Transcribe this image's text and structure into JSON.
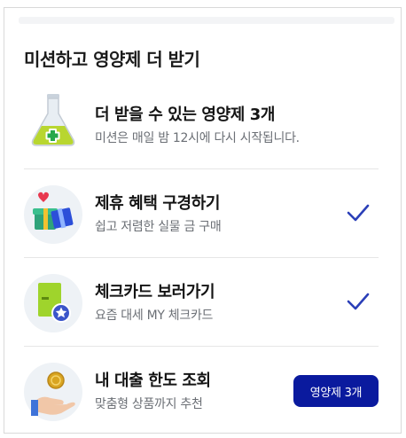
{
  "section": {
    "title": "미션하고 영양제 더 받기"
  },
  "summary": {
    "title": "더 받을 수 있는 영양제 3개",
    "subtitle": "미션은 매일 밤 12시에 다시 시작됩니다."
  },
  "missions": [
    {
      "title": "제휴 혜택 구경하기",
      "subtitle": "쉽고 저렴한 실물 금 구매",
      "icon": "gift-boxes-icon",
      "completed": true
    },
    {
      "title": "체크카드 보러가기",
      "subtitle": "요즘 대세 MY 체크카드",
      "icon": "check-card-icon",
      "completed": true
    },
    {
      "title": "내 대출 한도 조회",
      "subtitle": "맞춤형 상품까지 추천",
      "icon": "coin-hand-icon",
      "completed": false,
      "button_label": "영양제 3개"
    }
  ],
  "colors": {
    "accent": "#0a1a9e",
    "check": "#2b3fb8",
    "subtext": "#6b6f75"
  }
}
